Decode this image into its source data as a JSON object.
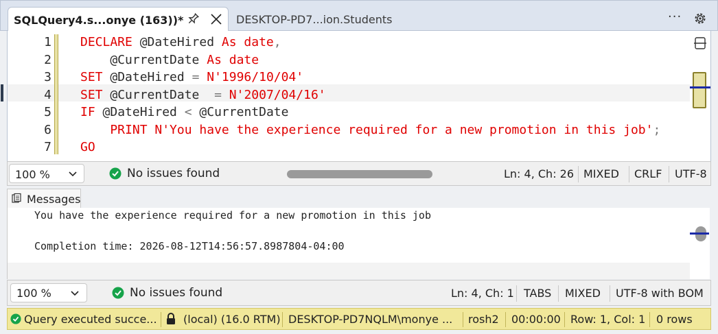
{
  "tabs": {
    "active_title": "SQLQuery4.s...onye (163))*",
    "inactive_title": "DESKTOP-PD7...ion.Students",
    "more_label": "···"
  },
  "editor": {
    "line_numbers": [
      "1",
      "2",
      "3",
      "4",
      "5",
      "6",
      "7"
    ],
    "lines": [
      [
        {
          "t": "DECLARE",
          "c": "kw"
        },
        {
          "t": " @DateHired ",
          "c": "id"
        },
        {
          "t": "As date",
          "c": "kw"
        },
        {
          "t": ",",
          "c": "op"
        }
      ],
      [
        {
          "t": "    @CurrentDate ",
          "c": "id"
        },
        {
          "t": "As date",
          "c": "kw"
        }
      ],
      [
        {
          "t": "SET",
          "c": "kw"
        },
        {
          "t": " @DateHired ",
          "c": "id"
        },
        {
          "t": "= ",
          "c": "op"
        },
        {
          "t": "N'1996/10/04'",
          "c": "str"
        }
      ],
      [
        {
          "t": "SET",
          "c": "kw"
        },
        {
          "t": " @CurrentDate  ",
          "c": "id"
        },
        {
          "t": "= ",
          "c": "op"
        },
        {
          "t": "N'2007/04/16'",
          "c": "str"
        }
      ],
      [
        {
          "t": "IF",
          "c": "kw"
        },
        {
          "t": " @DateHired ",
          "c": "id"
        },
        {
          "t": "< ",
          "c": "op"
        },
        {
          "t": "@CurrentDate",
          "c": "id"
        }
      ],
      [
        {
          "t": "    PRINT",
          "c": "kw"
        },
        {
          "t": " N'You have the experience required for a new promotion in this job'",
          "c": "str"
        },
        {
          "t": ";",
          "c": "op"
        }
      ],
      [
        {
          "t": "GO",
          "c": "kw"
        }
      ]
    ],
    "current_line": 4
  },
  "editor_status": {
    "zoom": "100 %",
    "issues": "No issues found",
    "position": "Ln: 4, Ch: 26",
    "whitespace": "MIXED",
    "line_ending": "CRLF",
    "encoding": "UTF-8"
  },
  "messages": {
    "tab_label": "Messages",
    "line1": "You have the experience required for a new promotion in this job",
    "line2": "Completion time: 2026-08-12T14:56:57.8987804-04:00"
  },
  "messages_status": {
    "zoom": "100 %",
    "issues": "No issues found",
    "position": "Ln: 4, Ch: 1",
    "indent": "TABS",
    "whitespace": "MIXED",
    "encoding": "UTF-8 with BOM"
  },
  "app_status": {
    "query_state": "Query  executed  succe...",
    "server": "(local) (16.0 RTM)",
    "user": "DESKTOP-PD7NQLM\\monye ...",
    "database": "rosh2",
    "elapsed": "00:00:00",
    "cursor": "Row: 1, Col: 1",
    "rows": "0 rows"
  },
  "colors": {
    "keyword": "#e00000",
    "string": "#e00000",
    "status_bar": "#f1e89a",
    "success": "#16a34a"
  }
}
